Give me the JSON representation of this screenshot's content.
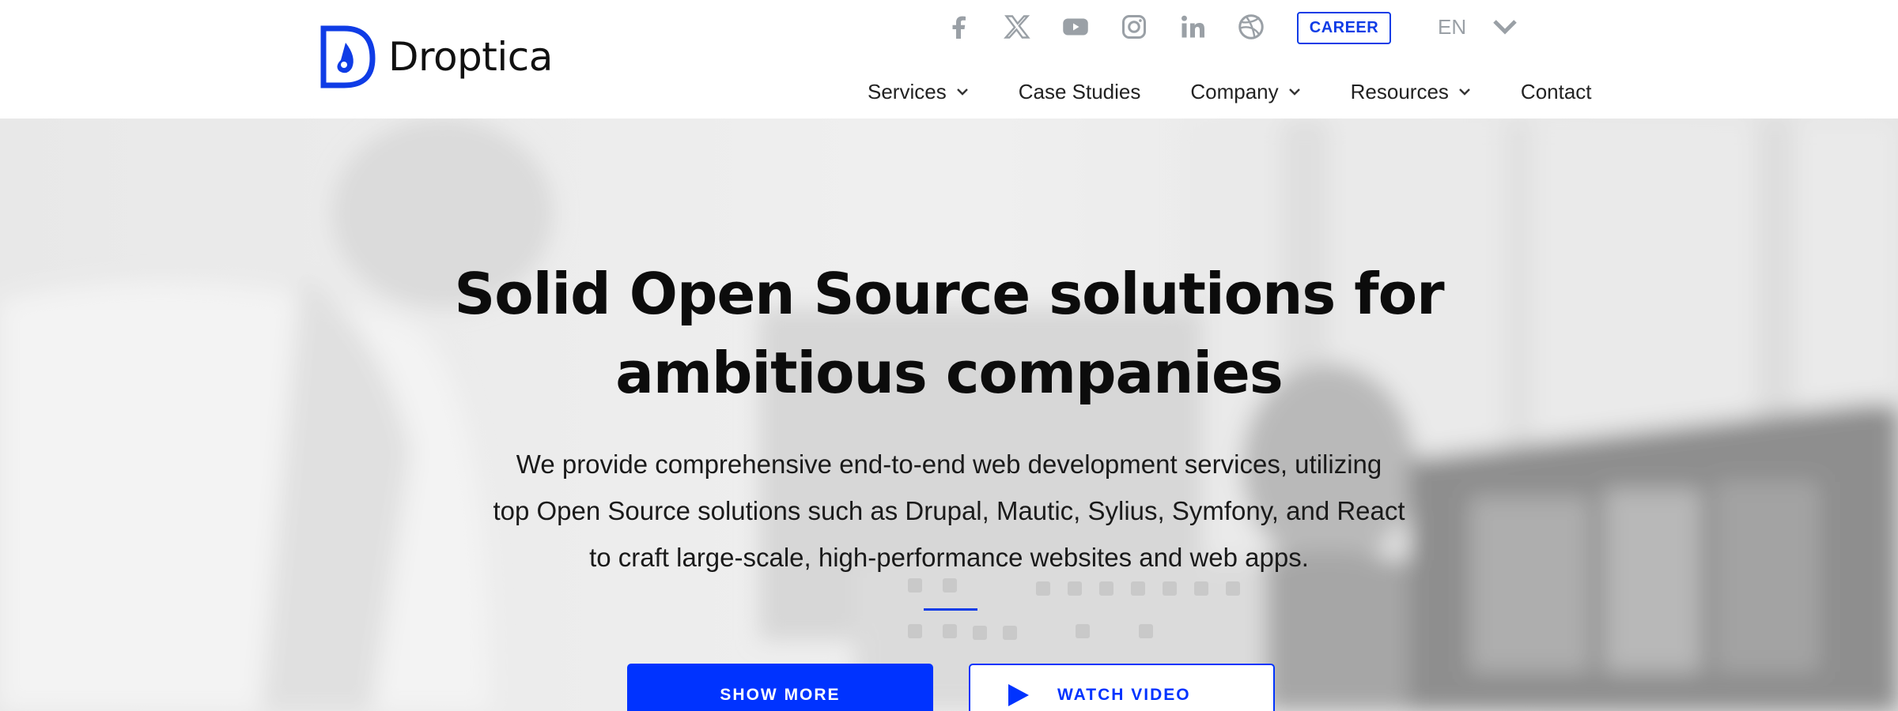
{
  "brand": {
    "name": "Droptica",
    "accent": "#0033ff"
  },
  "social": [
    {
      "icon": "facebook-icon"
    },
    {
      "icon": "x-twitter-icon"
    },
    {
      "icon": "youtube-icon"
    },
    {
      "icon": "instagram-icon"
    },
    {
      "icon": "linkedin-icon"
    },
    {
      "icon": "dribbble-icon"
    }
  ],
  "header": {
    "career_label": "CAREER",
    "language": "EN"
  },
  "nav": [
    {
      "label": "Services",
      "has_dropdown": true
    },
    {
      "label": "Case Studies",
      "has_dropdown": false
    },
    {
      "label": "Company",
      "has_dropdown": true
    },
    {
      "label": "Resources",
      "has_dropdown": true
    },
    {
      "label": "Contact",
      "has_dropdown": false
    }
  ],
  "hero": {
    "title_line1": "Solid Open Source solutions for",
    "title_line2": "ambitious companies",
    "subtitle_line1": "We provide comprehensive end-to-end web development services, utilizing",
    "subtitle_line2": "top Open Source solutions such as Drupal, Mautic, Sylius, Symfony, and React",
    "subtitle_line3": "to craft large-scale, high-performance websites and web apps.",
    "primary_button": "SHOW MORE",
    "secondary_button": "WATCH VIDEO"
  }
}
